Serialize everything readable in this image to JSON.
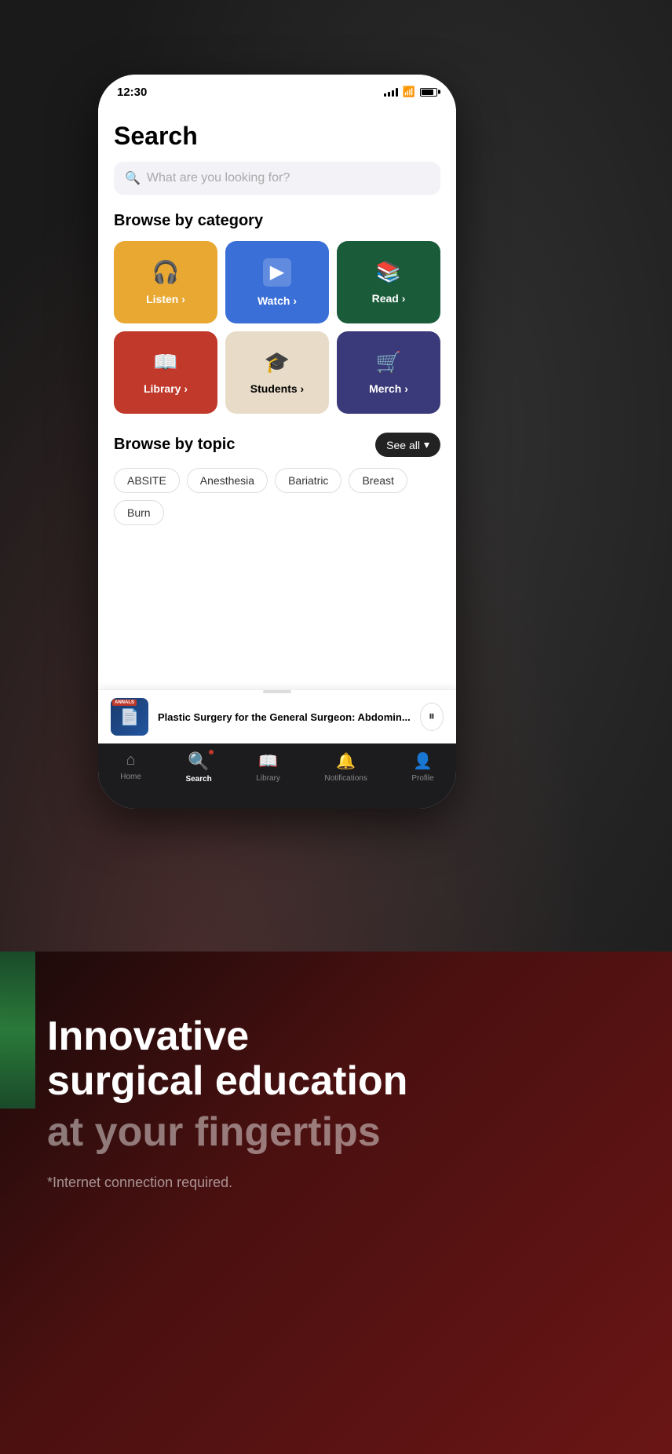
{
  "statusBar": {
    "time": "12:30"
  },
  "phone": {
    "pageTitle": "Search",
    "searchPlaceholder": "What are you looking for?",
    "browseCategoryTitle": "Browse by category",
    "categories": [
      {
        "id": "listen",
        "label": "Listen",
        "icon": "🎧",
        "arrow": "›",
        "colorClass": "listen"
      },
      {
        "id": "watch",
        "label": "Watch",
        "icon": "▶",
        "arrow": "›",
        "colorClass": "watch"
      },
      {
        "id": "read",
        "label": "Read",
        "icon": "📚",
        "arrow": "›",
        "colorClass": "read"
      },
      {
        "id": "library",
        "label": "Library",
        "icon": "📖",
        "arrow": "›",
        "colorClass": "library"
      },
      {
        "id": "students",
        "label": "Students",
        "icon": "🎓",
        "arrow": "›",
        "colorClass": "students"
      },
      {
        "id": "merch",
        "label": "Merch",
        "icon": "🛒",
        "arrow": "›",
        "colorClass": "merch"
      }
    ],
    "browseTopicTitle": "Browse by topic",
    "seeAllLabel": "See all",
    "topics": [
      "ABSITE",
      "Anesthesia",
      "Bariatric",
      "Breast",
      "Burn"
    ],
    "miniPlayer": {
      "title": "Plastic Surgery for the General Surgeon: Abdomin...",
      "badgeText": "ANNALS OF\nSURGERY\nJOURNAL CLUB"
    },
    "bottomNav": [
      {
        "id": "home",
        "icon": "⌂",
        "label": "Home",
        "active": false
      },
      {
        "id": "search",
        "icon": "⌕",
        "label": "Search",
        "active": true
      },
      {
        "id": "library",
        "icon": "📖",
        "label": "Library",
        "active": false
      },
      {
        "id": "notifications",
        "icon": "🔔",
        "label": "Notifications",
        "active": false
      },
      {
        "id": "profile",
        "icon": "👤",
        "label": "Profile",
        "active": false
      }
    ]
  },
  "bottomSection": {
    "taglineMain": "Innovative\nsurgical education",
    "taglineSub": "at your fingertips",
    "disclaimer": "*Internet connection required."
  }
}
